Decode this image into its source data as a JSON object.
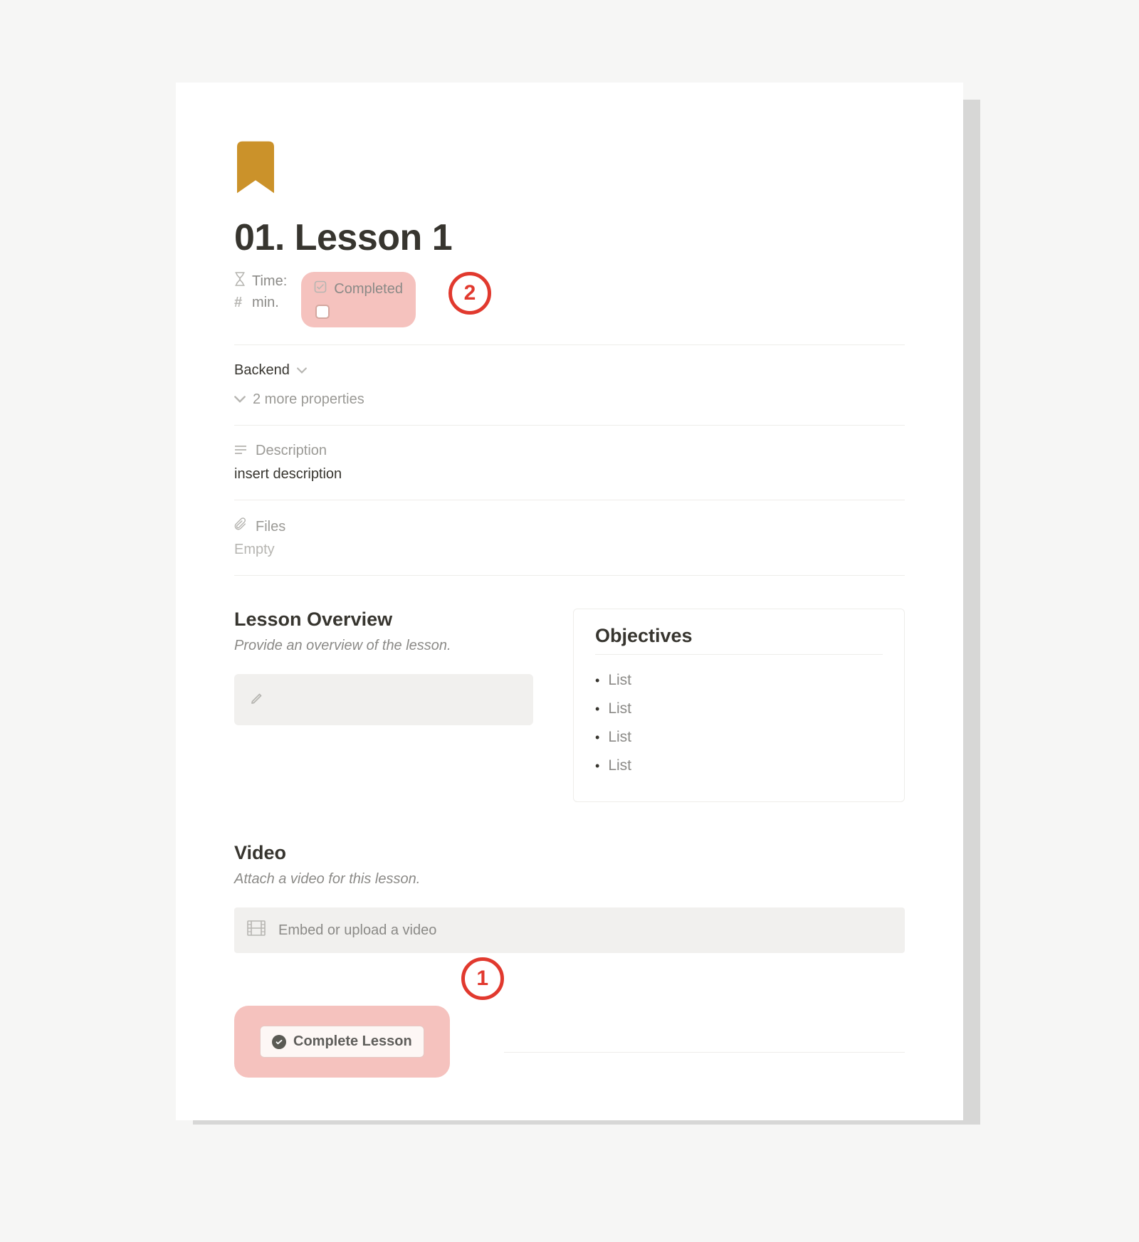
{
  "title": "01. Lesson 1",
  "properties": {
    "time_label": "Time:",
    "min_label": "min.",
    "completed_label": "Completed"
  },
  "annotations": {
    "step1": "1",
    "step2": "2"
  },
  "backend_label": "Backend",
  "more_properties_text": "2 more properties",
  "description": {
    "label": "Description",
    "text": "insert description"
  },
  "files": {
    "label": "Files",
    "empty_text": "Empty"
  },
  "overview": {
    "heading": "Lesson Overview",
    "subtitle": "Provide an overview of the lesson."
  },
  "objectives": {
    "heading": "Objectives",
    "items": [
      "List",
      "List",
      "List",
      "List"
    ]
  },
  "video": {
    "heading": "Video",
    "subtitle": "Attach a video for this lesson.",
    "placeholder": "Embed or upload a video"
  },
  "complete_button": "Complete Lesson"
}
